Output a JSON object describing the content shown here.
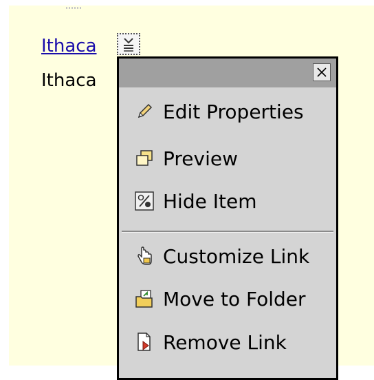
{
  "link": {
    "text": "Ithaca"
  },
  "plain": {
    "text": "Ithaca"
  },
  "menu": {
    "close_label": "X",
    "items": [
      {
        "label": "Edit Properties",
        "icon": "pencil-icon"
      },
      {
        "label": "Preview",
        "icon": "preview-window-icon"
      },
      {
        "label": "Hide Item",
        "icon": "percent-hide-icon"
      },
      {
        "label": "Customize Link",
        "icon": "hand-pointer-icon"
      },
      {
        "label": "Move to Folder",
        "icon": "folder-move-icon"
      },
      {
        "label": "Remove Link",
        "icon": "page-remove-icon"
      }
    ]
  },
  "colors": {
    "panel_background": "#ffffe0",
    "menu_background": "#d4d4d4",
    "menu_titlebar": "#a0a0a0",
    "link": "#1a0dab"
  }
}
